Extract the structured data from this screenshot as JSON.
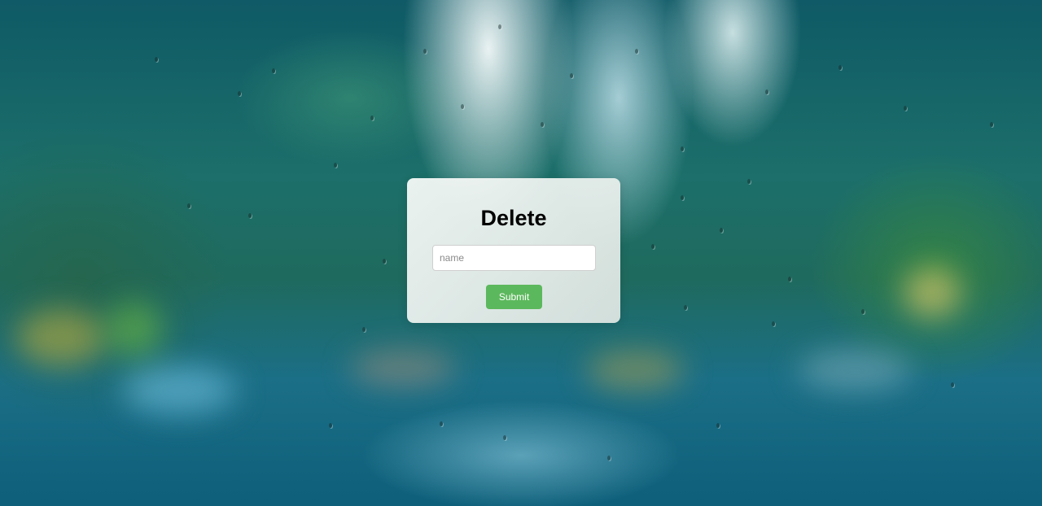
{
  "form": {
    "title": "Delete",
    "name_placeholder": "name",
    "name_value": "",
    "submit_label": "Submit"
  },
  "colors": {
    "submit_button": "#5cb85c",
    "title_text": "#000000"
  }
}
